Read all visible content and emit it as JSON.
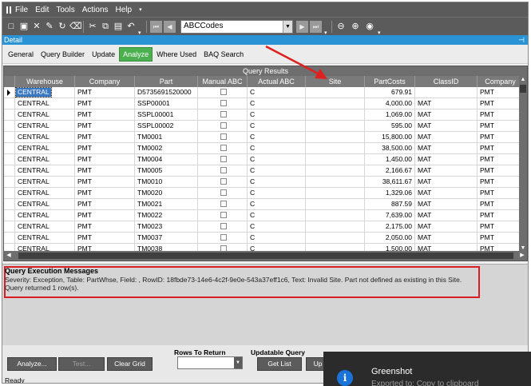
{
  "menu": [
    "File",
    "Edit",
    "Tools",
    "Actions",
    "Help"
  ],
  "toolbar": {
    "combo_value": "ABCCodes"
  },
  "panel": {
    "title": "Detail"
  },
  "tabs": [
    {
      "label": "General"
    },
    {
      "label": "Query Builder"
    },
    {
      "label": "Update"
    },
    {
      "label": "Analyze",
      "active": true
    },
    {
      "label": "Where Used"
    },
    {
      "label": "BAQ Search"
    }
  ],
  "grid": {
    "title": "Query Results",
    "columns": [
      "Warehouse",
      "Company",
      "Part",
      "Manual ABC",
      "Actual ABC",
      "Site",
      "PartCosts",
      "ClassID",
      "Company"
    ],
    "rows": [
      {
        "warehouse": "CENTRAL",
        "company": "PMT",
        "part": "D5735691520000",
        "actual": "C",
        "site": "",
        "cost": "679.91",
        "class": "",
        "company2": "PMT",
        "selected": true
      },
      {
        "warehouse": "CENTRAL",
        "company": "PMT",
        "part": "SSP00001",
        "actual": "C",
        "site": "",
        "cost": "4,000.00",
        "class": "MAT",
        "company2": "PMT"
      },
      {
        "warehouse": "CENTRAL",
        "company": "PMT",
        "part": "SSPL00001",
        "actual": "C",
        "site": "",
        "cost": "1,069.00",
        "class": "MAT",
        "company2": "PMT"
      },
      {
        "warehouse": "CENTRAL",
        "company": "PMT",
        "part": "SSPL00002",
        "actual": "C",
        "site": "",
        "cost": "595.00",
        "class": "MAT",
        "company2": "PMT"
      },
      {
        "warehouse": "CENTRAL",
        "company": "PMT",
        "part": "TM0001",
        "actual": "C",
        "site": "",
        "cost": "15,800.00",
        "class": "MAT",
        "company2": "PMT"
      },
      {
        "warehouse": "CENTRAL",
        "company": "PMT",
        "part": "TM0002",
        "actual": "C",
        "site": "",
        "cost": "38,500.00",
        "class": "MAT",
        "company2": "PMT"
      },
      {
        "warehouse": "CENTRAL",
        "company": "PMT",
        "part": "TM0004",
        "actual": "C",
        "site": "",
        "cost": "1,450.00",
        "class": "MAT",
        "company2": "PMT"
      },
      {
        "warehouse": "CENTRAL",
        "company": "PMT",
        "part": "TM0005",
        "actual": "C",
        "site": "",
        "cost": "2,166.67",
        "class": "MAT",
        "company2": "PMT"
      },
      {
        "warehouse": "CENTRAL",
        "company": "PMT",
        "part": "TM0010",
        "actual": "C",
        "site": "",
        "cost": "38,611.67",
        "class": "MAT",
        "company2": "PMT"
      },
      {
        "warehouse": "CENTRAL",
        "company": "PMT",
        "part": "TM0020",
        "actual": "C",
        "site": "",
        "cost": "1,329.06",
        "class": "MAT",
        "company2": "PMT"
      },
      {
        "warehouse": "CENTRAL",
        "company": "PMT",
        "part": "TM0021",
        "actual": "C",
        "site": "",
        "cost": "887.59",
        "class": "MAT",
        "company2": "PMT"
      },
      {
        "warehouse": "CENTRAL",
        "company": "PMT",
        "part": "TM0022",
        "actual": "C",
        "site": "",
        "cost": "7,639.00",
        "class": "MAT",
        "company2": "PMT"
      },
      {
        "warehouse": "CENTRAL",
        "company": "PMT",
        "part": "TM0023",
        "actual": "C",
        "site": "",
        "cost": "2,175.00",
        "class": "MAT",
        "company2": "PMT"
      },
      {
        "warehouse": "CENTRAL",
        "company": "PMT",
        "part": "TM0037",
        "actual": "C",
        "site": "",
        "cost": "2,050.00",
        "class": "MAT",
        "company2": "PMT"
      },
      {
        "warehouse": "CENTRAL",
        "company": "PMT",
        "part": "TM0038",
        "actual": "C",
        "site": "",
        "cost": "1,500.00",
        "class": "MAT",
        "company2": "PMT"
      }
    ]
  },
  "messages": {
    "title": "Query Execution Messages",
    "line1": "Severity: Exception, Table: PartWhse, Field: , RowID: 18fbde73-14e6-4c2f-9e0e-543a37eff1c6, Text: Invalid Site. Part not defined as existing in this Site.",
    "line2": "Query returned 1 row(s)."
  },
  "bottom": {
    "analyze": "Analyze...",
    "test": "Test...",
    "clear": "Clear Grid",
    "rows_to_return": "Rows To Return",
    "updatable": "Updatable Query",
    "get_list": "Get List",
    "up": "Up"
  },
  "status": "Ready",
  "toast": {
    "title": "Greenshot",
    "subtitle": "Exported to: Copy to clipboard"
  },
  "colors": {
    "accent_blue": "#2a93d5",
    "active_tab": "#4caf50",
    "highlight_red": "#d91f26",
    "toolbar": "#5b5b5b"
  }
}
